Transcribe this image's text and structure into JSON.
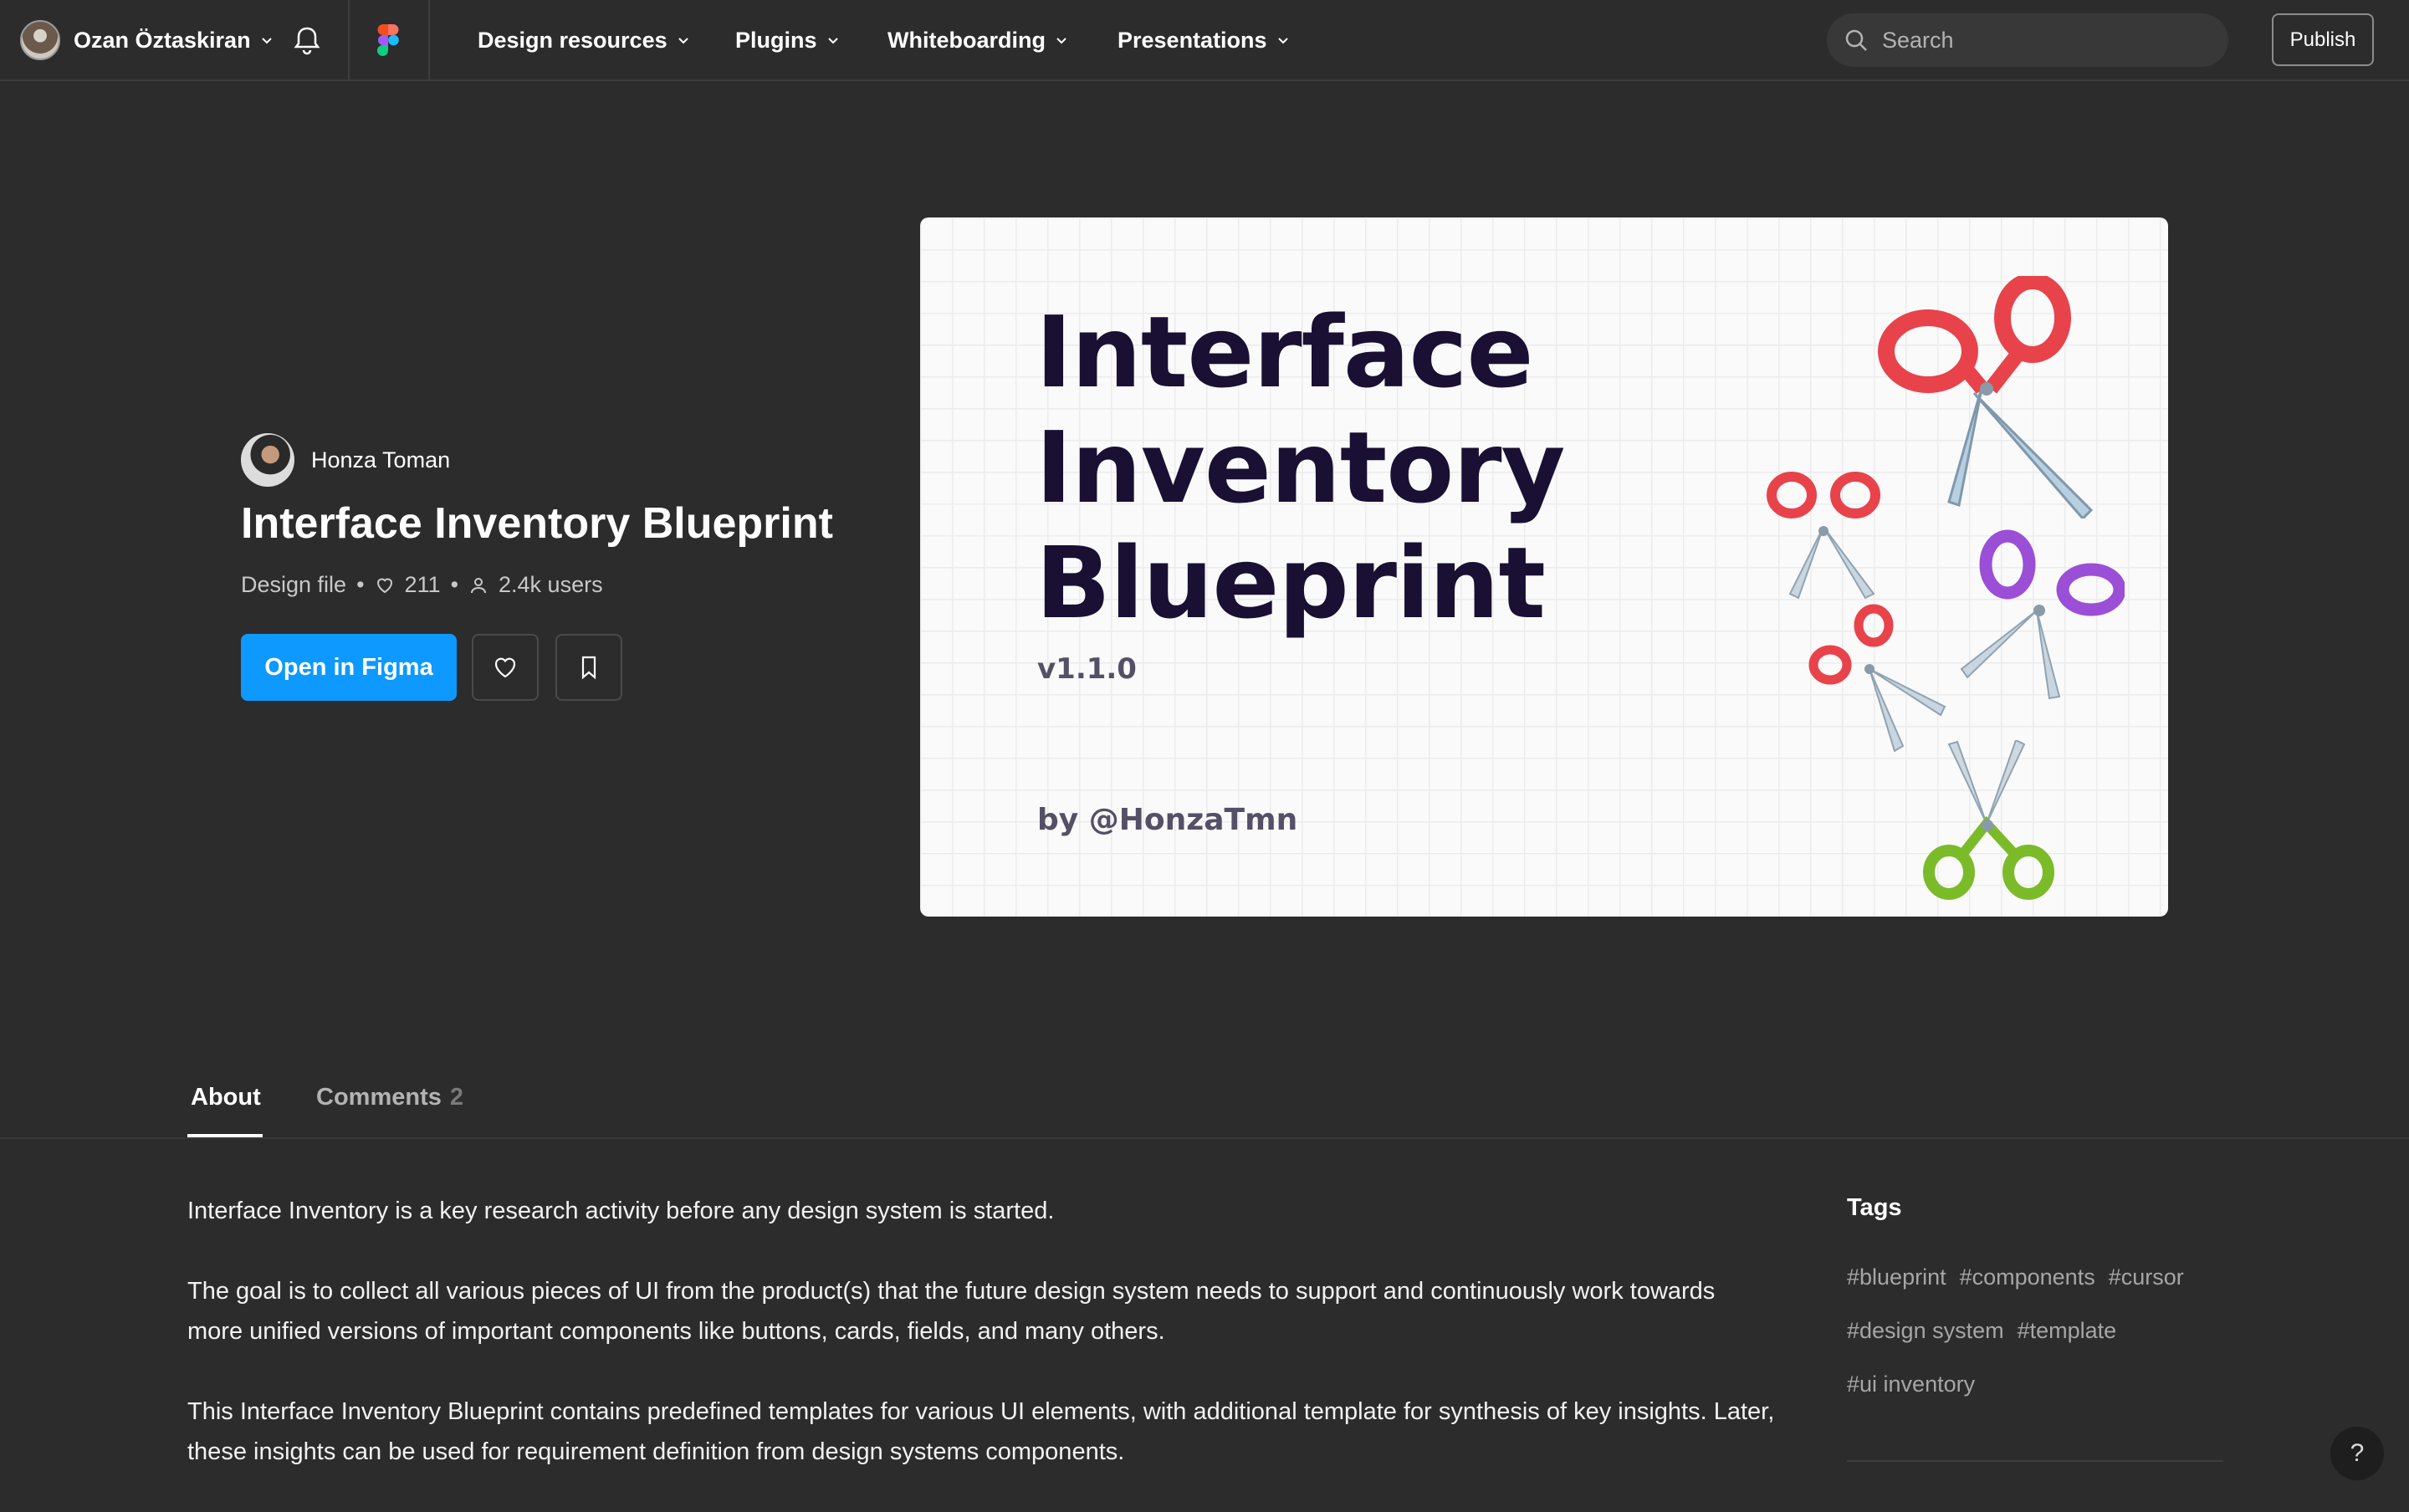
{
  "topbar": {
    "user_name": "Ozan Öztaskiran",
    "nav": [
      "Design resources",
      "Plugins",
      "Whiteboarding",
      "Presentations"
    ],
    "search_placeholder": "Search",
    "publish_label": "Publish"
  },
  "file": {
    "author": "Honza Toman",
    "title": "Interface Inventory Blueprint",
    "type": "Design file",
    "likes": "211",
    "users": "2.4k users",
    "open_label": "Open in Figma"
  },
  "thumbnail": {
    "title_lines": [
      "Interface",
      "Inventory",
      "Blueprint"
    ],
    "version": "v1.1.0",
    "byline": "by @HonzaTmn"
  },
  "tabs": {
    "about": "About",
    "comments": "Comments",
    "comments_count": "2"
  },
  "about": {
    "paragraphs": [
      "Interface Inventory is a key research activity before any design system is started.",
      "The goal is to collect all various pieces of UI from the product(s) that the future design system needs to support and continuously work towards more unified versions of important components like buttons, cards, fields, and many others.",
      "This Interface Inventory Blueprint contains predefined templates for various UI elements, with additional template for synthesis of key insights. Later, these insights can be used for requirement definition from design systems components."
    ]
  },
  "tags": {
    "title": "Tags",
    "rows": [
      [
        "#blueprint",
        "#components",
        "#cursor"
      ],
      [
        "#design system",
        "#template"
      ],
      [
        "#ui inventory"
      ]
    ]
  },
  "help_label": "?",
  "colors": {
    "background": "#2c2c2c",
    "accent": "#0d99ff",
    "thumb_title": "#1a1033"
  }
}
